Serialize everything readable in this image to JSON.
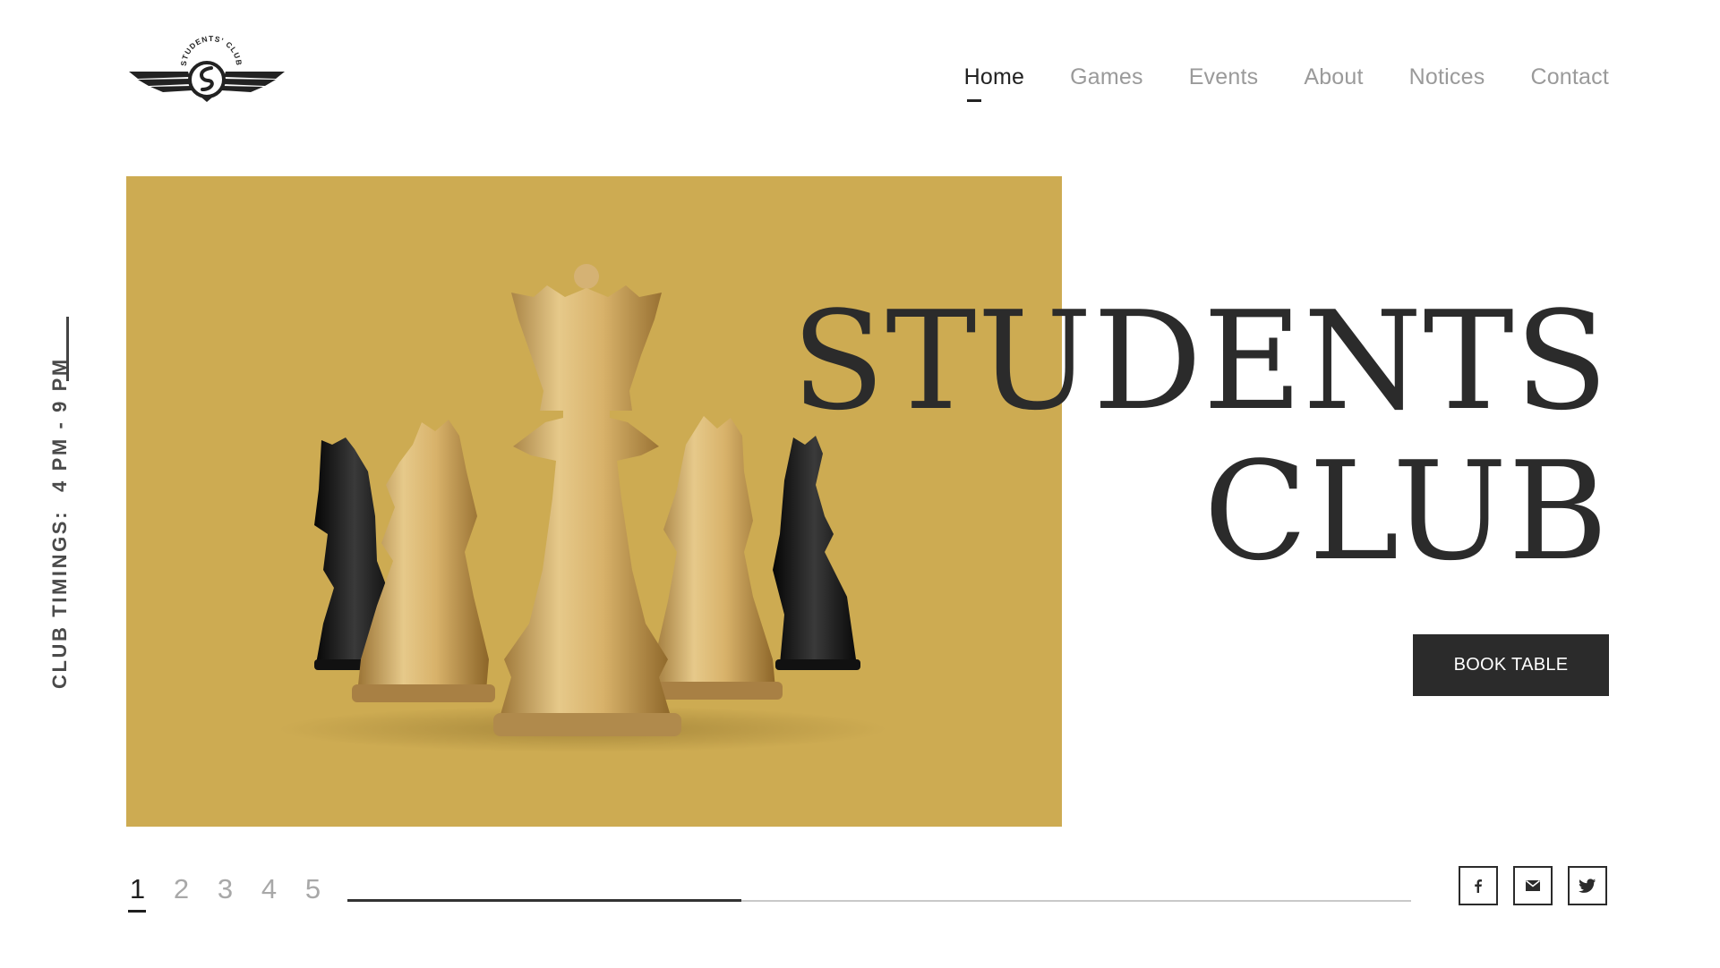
{
  "logo": {
    "text": "STUDENTS' CLUB"
  },
  "nav": {
    "items": [
      {
        "label": "Home",
        "active": true
      },
      {
        "label": "Games",
        "active": false
      },
      {
        "label": "Events",
        "active": false
      },
      {
        "label": "About",
        "active": false
      },
      {
        "label": "Notices",
        "active": false
      },
      {
        "label": "Contact",
        "active": false
      }
    ]
  },
  "side": {
    "label": "CLUB TIMINGS:",
    "hours": "4 PM - 9 PM"
  },
  "hero": {
    "title_line1": "STUDENTS",
    "title_line2": "CLUB",
    "cta": "BOOK TABLE",
    "image_bg": "#cdab52"
  },
  "pager": {
    "pages": [
      "1",
      "2",
      "3",
      "4",
      "5"
    ],
    "current": 1,
    "progress": 0.37
  },
  "social": {
    "icons": [
      "facebook-icon",
      "mail-icon",
      "twitter-icon"
    ]
  },
  "colors": {
    "text_dark": "#2b2b2b",
    "text_muted": "#9a9a9a",
    "accent_gold": "#cdab52"
  }
}
